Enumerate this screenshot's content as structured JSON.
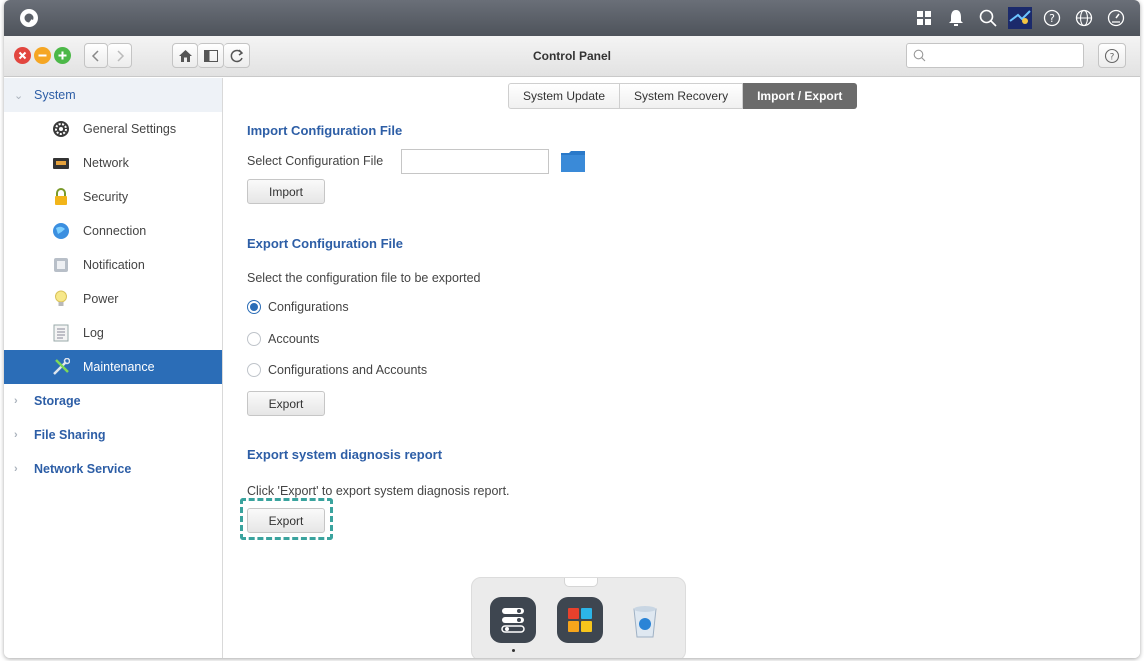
{
  "window": {
    "title": "Control Panel"
  },
  "search": {
    "placeholder": ""
  },
  "sidebar": {
    "sections": [
      {
        "label": "System"
      },
      {
        "label": "Storage"
      },
      {
        "label": "File Sharing"
      },
      {
        "label": "Network Service"
      }
    ],
    "items": [
      {
        "label": "General Settings",
        "icon": "gear-icon"
      },
      {
        "label": "Network",
        "icon": "network-icon"
      },
      {
        "label": "Security",
        "icon": "lock-icon"
      },
      {
        "label": "Connection",
        "icon": "globe-icon"
      },
      {
        "label": "Notification",
        "icon": "notification-icon"
      },
      {
        "label": "Power",
        "icon": "bulb-icon"
      },
      {
        "label": "Log",
        "icon": "log-icon"
      },
      {
        "label": "Maintenance",
        "icon": "tools-icon",
        "active": true
      }
    ]
  },
  "tabs": [
    {
      "label": "System Update"
    },
    {
      "label": "System Recovery"
    },
    {
      "label": "Import / Export",
      "active": true
    }
  ],
  "import": {
    "heading": "Import Configuration File",
    "select_label": "Select Configuration File",
    "file_value": "",
    "button": "Import"
  },
  "export": {
    "heading": "Export Configuration File",
    "prompt": "Select the configuration file to be exported",
    "options": [
      {
        "label": "Configurations",
        "selected": true
      },
      {
        "label": "Accounts",
        "selected": false
      },
      {
        "label": "Configurations and Accounts",
        "selected": false
      }
    ],
    "button": "Export"
  },
  "diagnosis": {
    "heading": "Export system diagnosis report",
    "text": "Click 'Export' to export system diagnosis report.",
    "button": "Export"
  },
  "colors": {
    "accent": "#2b6db7",
    "heading": "#2d5ea6",
    "highlight": "#3aa39e"
  }
}
